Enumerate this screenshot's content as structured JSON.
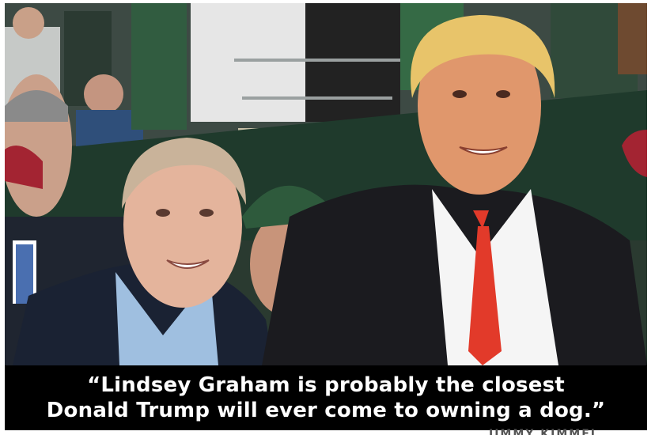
{
  "caption": {
    "line1": "“Lindsey Graham is probably the closest",
    "line2": "Donald Trump will ever come to owning a dog.”"
  },
  "credit": "JIMMY KIMMEL",
  "colors": {
    "caption_bg": "#000000",
    "caption_text": "#ffffff",
    "frame": "#ffffff",
    "tie": "#e23a2a"
  }
}
